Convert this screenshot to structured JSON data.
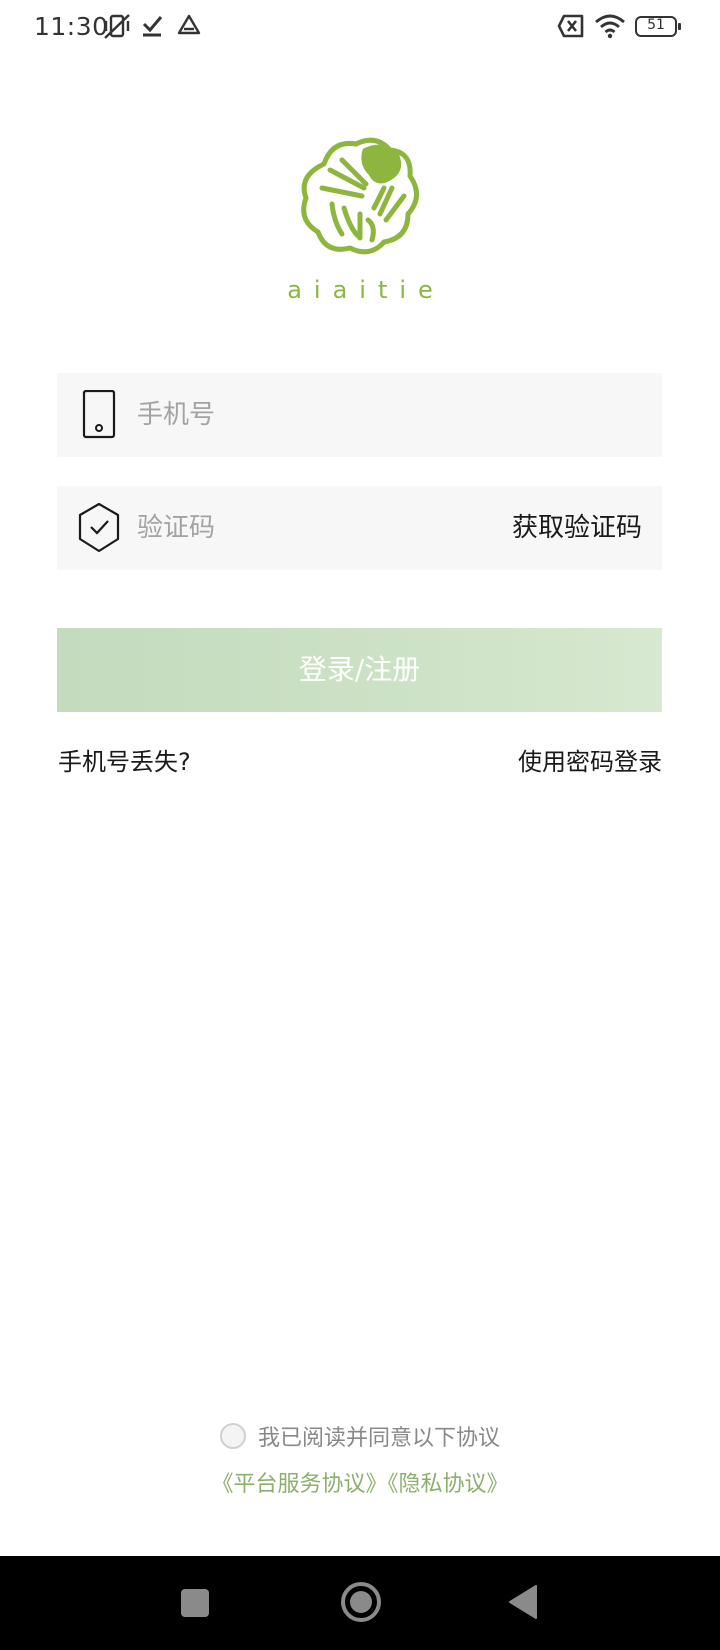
{
  "status_bar": {
    "time": "11:30",
    "battery": "51",
    "icons": [
      "vibrate-off-icon",
      "check-icon",
      "drive-icon",
      "no-sim-icon",
      "wifi-icon",
      "battery-icon"
    ]
  },
  "logo": {
    "text": "aiaitie",
    "color": "#8db63f"
  },
  "phone_field": {
    "placeholder": "手机号",
    "icon": "phone-icon"
  },
  "code_field": {
    "placeholder": "验证码",
    "icon": "shield-check-icon",
    "get_code_label": "获取验证码"
  },
  "login_button": {
    "label": "登录/注册",
    "colors": [
      "#c4dbbd",
      "#d7e9d0"
    ]
  },
  "links": {
    "lost_phone": "手机号丢失?",
    "password_login": "使用密码登录"
  },
  "agreement": {
    "text": "我已阅读并同意以下协议",
    "service_link": "《平台服务协议》",
    "privacy_link": "《隐私协议》",
    "link_color": "#8cb06c"
  },
  "nav_bar": {
    "buttons": [
      "recents-button",
      "home-button",
      "back-button"
    ]
  }
}
